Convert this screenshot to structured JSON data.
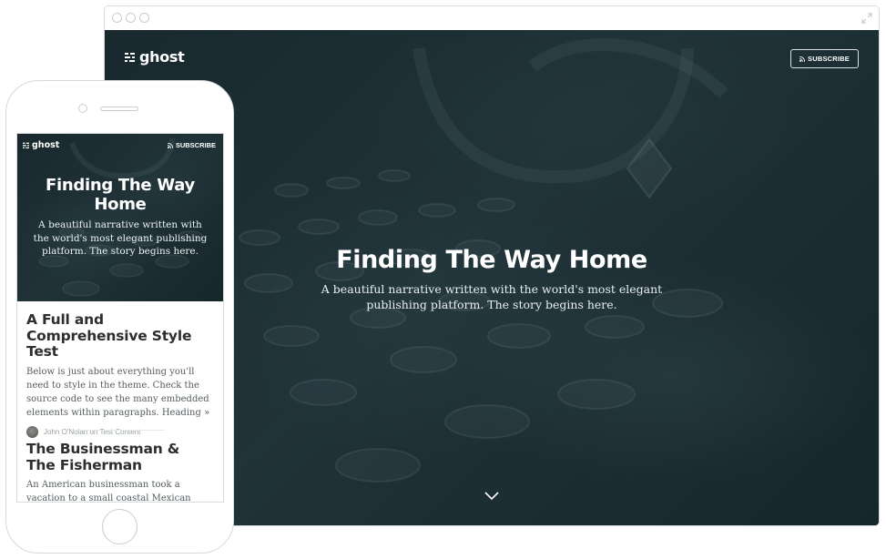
{
  "browser": {
    "controls": [
      "close",
      "minimize",
      "zoom"
    ],
    "expand_icon": "expand-icon"
  },
  "desktop": {
    "logo_text": "ghost",
    "subscribe_label": "SUBSCRIBE",
    "title": "Finding The Way Home",
    "description": "A beautiful narrative written with the world's most elegant publishing platform. The story begins here.",
    "scroll_icon": "chevron-down-icon"
  },
  "mobile": {
    "logo_text": "ghost",
    "subscribe_label": "SUBSCRIBE",
    "title": "Finding The Way Home",
    "description": "A beautiful narrative written with the world's most elegant publishing platform. The story begins here.",
    "posts": [
      {
        "title": "A Full and Comprehensive Style Test",
        "excerpt": "Below is just about everything you'll need to style in the theme. Check the source code to see the many embedded elements within paragraphs. Heading",
        "more": "»",
        "author": "John O'Nolan",
        "meta_on": "on",
        "tag": "Test Content"
      },
      {
        "title": "The Businessman & The Fisherman",
        "excerpt": "An American businessman took a vacation to a small coastal Mexican village on doctor's"
      }
    ]
  },
  "colors": {
    "hero_overlay": "#1f3035",
    "heading_text": "#2e2e2e",
    "body_text": "#555c5f",
    "meta_text": "#9aa1a4",
    "frame_border": "#d7dbdd"
  }
}
